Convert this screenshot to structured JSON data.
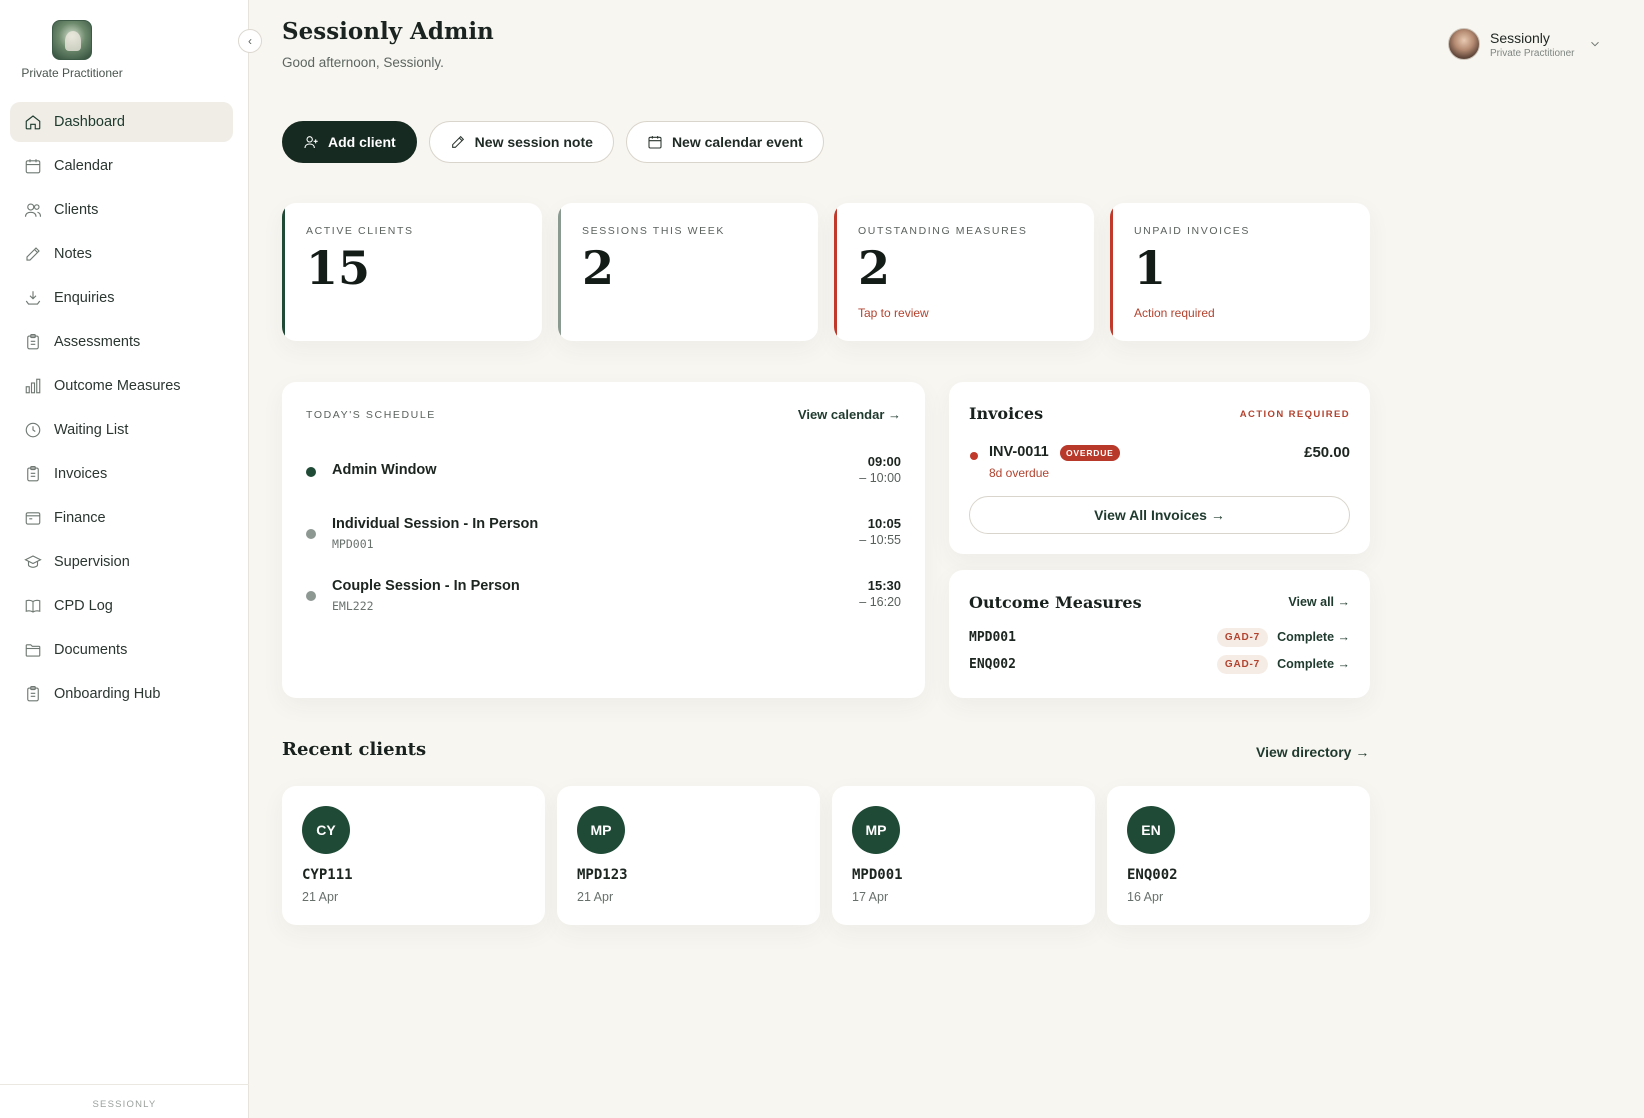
{
  "sidebar": {
    "brand_label": "Private Practitioner",
    "items": [
      {
        "label": "Dashboard",
        "icon": "home-icon",
        "active": true
      },
      {
        "label": "Calendar",
        "icon": "calendar-icon"
      },
      {
        "label": "Clients",
        "icon": "users-icon"
      },
      {
        "label": "Notes",
        "icon": "edit-icon"
      },
      {
        "label": "Enquiries",
        "icon": "inbox-download-icon"
      },
      {
        "label": "Assessments",
        "icon": "clipboard-icon"
      },
      {
        "label": "Outcome Measures",
        "icon": "bar-chart-icon"
      },
      {
        "label": "Waiting List",
        "icon": "clock-icon"
      },
      {
        "label": "Invoices",
        "icon": "clipboard-icon"
      },
      {
        "label": "Finance",
        "icon": "wallet-icon"
      },
      {
        "label": "Supervision",
        "icon": "graduation-cap-icon"
      },
      {
        "label": "CPD Log",
        "icon": "book-icon"
      },
      {
        "label": "Documents",
        "icon": "folder-icon"
      },
      {
        "label": "Onboarding Hub",
        "icon": "clipboard-icon"
      }
    ],
    "footer": "SESSIONLY"
  },
  "header": {
    "title": "Sessionly Admin",
    "subtitle": "Good afternoon, Sessionly.",
    "user_name": "Sessionly",
    "user_role": "Private Practitioner"
  },
  "actions": {
    "add_client": "Add client",
    "new_note": "New session note",
    "new_event": "New calendar event"
  },
  "stats": [
    {
      "label": "ACTIVE CLIENTS",
      "value": "15",
      "note": "",
      "accent": "#1f4a36"
    },
    {
      "label": "SESSIONS THIS WEEK",
      "value": "2",
      "note": "",
      "accent": "#8a9a90"
    },
    {
      "label": "OUTSTANDING MEASURES",
      "value": "2",
      "note": "Tap to review",
      "accent": "#c0392b"
    },
    {
      "label": "UNPAID INVOICES",
      "value": "1",
      "note": "Action required",
      "accent": "#c0392b"
    }
  ],
  "schedule": {
    "label": "TODAY'S SCHEDULE",
    "link": "View calendar →",
    "items": [
      {
        "title": "Admin Window",
        "code": "",
        "start": "09:00",
        "end": "– 10:00",
        "dot": "#1f4a36"
      },
      {
        "title": "Individual Session - In Person",
        "code": "MPD001",
        "start": "10:05",
        "end": "– 10:55",
        "dot": "#8e9893"
      },
      {
        "title": "Couple Session - In Person",
        "code": "EML222",
        "start": "15:30",
        "end": "– 16:20",
        "dot": "#8e9893"
      }
    ]
  },
  "invoices": {
    "title": "Invoices",
    "flag": "ACTION REQUIRED",
    "item": {
      "id": "INV-0011",
      "badge": "OVERDUE",
      "sub": "8d overdue",
      "amount": "£50.00"
    },
    "button": "View All Invoices →"
  },
  "outcomes": {
    "title": "Outcome Measures",
    "link": "View all →",
    "rows": [
      {
        "code": "MPD001",
        "tag": "GAD-7",
        "action": "Complete →"
      },
      {
        "code": "ENQ002",
        "tag": "GAD-7",
        "action": "Complete →"
      }
    ]
  },
  "recent": {
    "title": "Recent clients",
    "link": "View directory →",
    "clients": [
      {
        "initials": "CY",
        "code": "CYP111",
        "date": "21 Apr"
      },
      {
        "initials": "MP",
        "code": "MPD123",
        "date": "21 Apr"
      },
      {
        "initials": "MP",
        "code": "MPD001",
        "date": "17 Apr"
      },
      {
        "initials": "EN",
        "code": "ENQ002",
        "date": "16 Apr"
      }
    ]
  },
  "colors": {
    "brand_dark": "#172a21",
    "accent_green": "#1f4a36",
    "alert_red": "#c0392b",
    "background": "#f8f6f1"
  }
}
